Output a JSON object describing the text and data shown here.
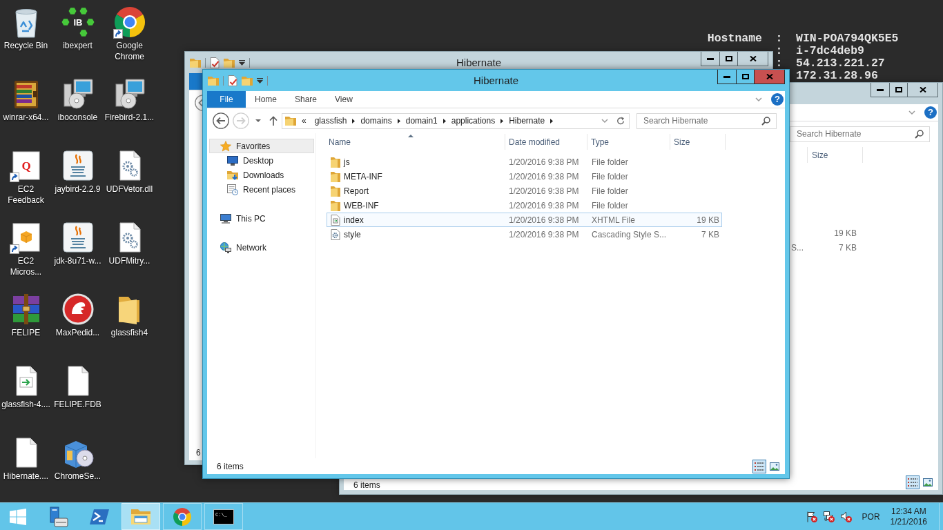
{
  "desktop_icons": [
    {
      "label": "Recycle Bin",
      "kind": "recycle-bin",
      "shortcut": false
    },
    {
      "label": "winrar-x64...",
      "kind": "archive-book",
      "shortcut": false
    },
    {
      "label": "EC2 Feedback",
      "kind": "letter-page",
      "glyph": "Q",
      "shortcut": true
    },
    {
      "label": "EC2 Micros...",
      "kind": "cube-page",
      "shortcut": true
    },
    {
      "label": "FELIPE",
      "kind": "book-stack",
      "shortcut": false
    },
    {
      "label": "glassfish-4....",
      "kind": "arrow-page",
      "shortcut": false
    },
    {
      "label": "Hibernate....",
      "kind": "blank-page",
      "shortcut": false
    },
    {
      "label": "ibexpert",
      "kind": "hex-logo",
      "glyph": "IB",
      "shortcut": false
    },
    {
      "label": "iboconsole",
      "kind": "installer",
      "shortcut": false
    },
    {
      "label": "jaybird-2.2.9",
      "kind": "java",
      "shortcut": false
    },
    {
      "label": "jdk-8u71-w...",
      "kind": "java",
      "shortcut": false
    },
    {
      "label": "MaxPedid...",
      "kind": "helmet-badge",
      "shortcut": false
    },
    {
      "label": "FELIPE.FDB",
      "kind": "blank-page",
      "shortcut": false
    },
    {
      "label": "ChromeSe...",
      "kind": "setup-box",
      "shortcut": false
    },
    {
      "label": "Google Chrome",
      "kind": "browser",
      "shortcut": true
    },
    {
      "label": "Firebird-2.1...",
      "kind": "installer",
      "shortcut": false
    },
    {
      "label": "UDFVetor.dll",
      "kind": "gear-page",
      "shortcut": false
    },
    {
      "label": "UDFMitry...",
      "kind": "gear-page",
      "shortcut": false
    },
    {
      "label": "glassfish4",
      "kind": "folder",
      "shortcut": false
    }
  ],
  "bginfo": [
    {
      "label": "Hostname",
      "separator": ":",
      "value": "WIN-POA794QK5E5"
    },
    {
      "separator": ":",
      "value": "i-7dc4deb9"
    },
    {
      "separator": ":",
      "value": "54.213.221.27"
    },
    {
      "value": "172.31.28.96"
    }
  ],
  "back_window": {
    "active": false,
    "title": "Hibernate",
    "status": "6"
  },
  "right_window": {
    "active": false,
    "help": "?",
    "search": {
      "placeholder": "Search Hibernate"
    },
    "columns": [
      {
        "label": "Size"
      }
    ],
    "files": [
      {
        "size": "19 KB"
      },
      {
        "type": "S...",
        "size": "7 KB"
      }
    ],
    "status": "6 items",
    "views": [
      {
        "kind": "details",
        "selected": true
      },
      {
        "kind": "large-icons",
        "selected": false
      }
    ]
  },
  "explorer": {
    "active": true,
    "title": "Hibernate",
    "tabs": [
      {
        "label": "File",
        "kind": "backstage"
      },
      {
        "label": "Home",
        "kind": "tab"
      },
      {
        "label": "Share",
        "kind": "tab"
      },
      {
        "label": "View",
        "kind": "tab"
      }
    ],
    "help": "?",
    "navigation": {
      "back": {
        "disabled": false
      },
      "forward": {
        "disabled": true
      }
    },
    "address": {
      "overflow": "«",
      "crumbs": [
        "glassfish",
        "domains",
        "domain1",
        "applications",
        "Hibernate"
      ]
    },
    "search": {
      "placeholder": "Search Hibernate"
    },
    "nav_pane": [
      {
        "label": "Favorites",
        "kind": "star",
        "selected": true,
        "children": [
          {
            "label": "Desktop",
            "kind": "desktop",
            "selected": false
          },
          {
            "label": "Downloads",
            "kind": "downloads",
            "selected": false
          },
          {
            "label": "Recent places",
            "kind": "recent",
            "selected": false
          }
        ]
      },
      {
        "label": "This PC",
        "kind": "computer",
        "selected": false
      },
      {
        "label": "Network",
        "kind": "network",
        "selected": false
      }
    ],
    "columns": [
      {
        "label": "Name",
        "sorted": true
      },
      {
        "label": "Date modified",
        "sorted": false
      },
      {
        "label": "Type",
        "sorted": false
      },
      {
        "label": "Size",
        "sorted": false
      }
    ],
    "files": [
      {
        "name": "js",
        "kind": "folder",
        "date": "1/20/2016 9:38 PM",
        "type": "File folder",
        "selected": false
      },
      {
        "name": "META-INF",
        "kind": "folder",
        "date": "1/20/2016 9:38 PM",
        "type": "File folder",
        "selected": false
      },
      {
        "name": "Report",
        "kind": "folder",
        "date": "1/20/2016 9:38 PM",
        "type": "File folder",
        "selected": false
      },
      {
        "name": "WEB-INF",
        "kind": "folder",
        "date": "1/20/2016 9:38 PM",
        "type": "File folder",
        "selected": false
      },
      {
        "name": "index",
        "kind": "xhtml",
        "date": "1/20/2016 9:38 PM",
        "type": "XHTML File",
        "size": "19 KB",
        "selected": true
      },
      {
        "name": "style",
        "kind": "css",
        "date": "1/20/2016 9:38 PM",
        "type": "Cascading Style S...",
        "size": "7 KB",
        "selected": false
      }
    ],
    "status": "6 items",
    "views": [
      {
        "kind": "details",
        "selected": true
      },
      {
        "kind": "large-icons",
        "selected": false
      }
    ]
  },
  "taskbar": {
    "apps": [
      {
        "kind": "server-manager",
        "running": false,
        "active": false
      },
      {
        "kind": "shell",
        "running": false,
        "active": false
      },
      {
        "kind": "explorer",
        "running": true,
        "active": true
      },
      {
        "kind": "browser",
        "running": true,
        "active": false
      },
      {
        "kind": "terminal",
        "glyph": "C:\\_",
        "running": true,
        "active": false
      }
    ],
    "tray": [
      {
        "kind": "flag-error"
      },
      {
        "kind": "network-error"
      },
      {
        "kind": "speaker-muted"
      }
    ],
    "language": "POR",
    "time": "12:34 AM",
    "date": "1/21/2016"
  }
}
